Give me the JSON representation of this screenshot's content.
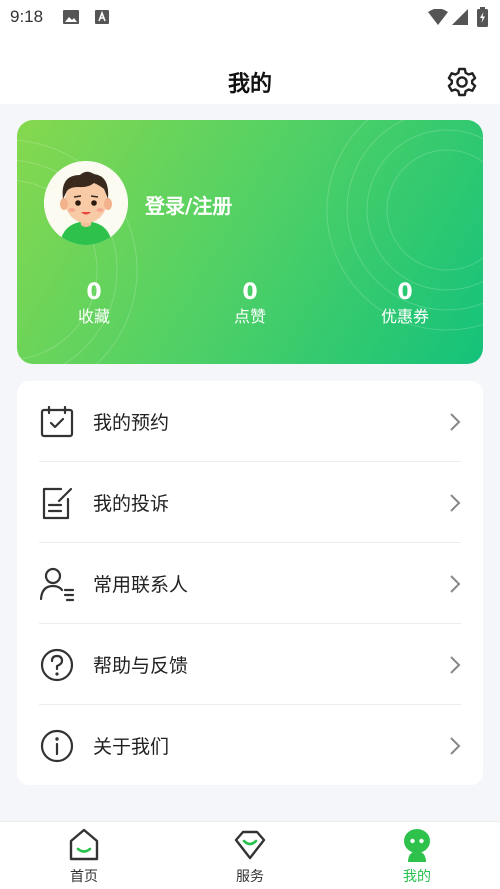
{
  "status_bar": {
    "time": "9:18"
  },
  "header": {
    "title": "我的"
  },
  "profile": {
    "login_label": "登录/注册",
    "stats": [
      {
        "value": "0",
        "label": "收藏"
      },
      {
        "value": "0",
        "label": "点赞"
      },
      {
        "value": "0",
        "label": "优惠券"
      }
    ]
  },
  "menu": {
    "items": [
      {
        "label": "我的预约",
        "icon": "calendar-check-icon"
      },
      {
        "label": "我的投诉",
        "icon": "edit-document-icon"
      },
      {
        "label": "常用联系人",
        "icon": "contact-list-icon"
      },
      {
        "label": "帮助与反馈",
        "icon": "help-icon"
      },
      {
        "label": "关于我们",
        "icon": "info-icon"
      }
    ]
  },
  "bottom_nav": {
    "items": [
      {
        "label": "首页",
        "icon": "home-icon",
        "active": false
      },
      {
        "label": "服务",
        "icon": "service-icon",
        "active": false
      },
      {
        "label": "我的",
        "icon": "profile-icon",
        "active": true
      }
    ]
  },
  "colors": {
    "accent": "#27c14c",
    "card_gradient_start": "#86d84e",
    "card_gradient_end": "#14c27a",
    "background": "#f5f6f9"
  }
}
